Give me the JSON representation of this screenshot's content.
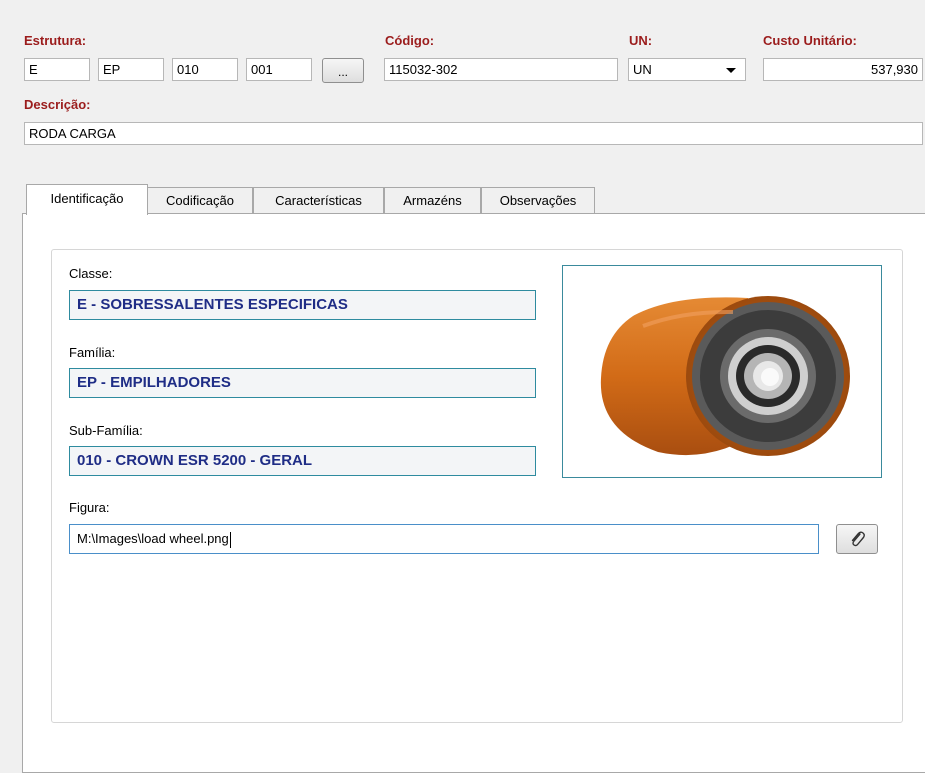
{
  "header": {
    "estrutura_label": "Estrutura:",
    "estrutura_values": [
      "E",
      "EP",
      "010",
      "001"
    ],
    "browse_label": "...",
    "codigo_label": "Código:",
    "codigo_value": "115032-302",
    "un_label": "UN:",
    "un_value": "UN",
    "custo_label": "Custo Unitário:",
    "custo_value": "537,930",
    "descricao_label": "Descrição:",
    "descricao_value": "RODA CARGA"
  },
  "tabs": [
    {
      "label": "Identificação",
      "active": true
    },
    {
      "label": "Codificação",
      "active": false
    },
    {
      "label": "Características",
      "active": false
    },
    {
      "label": "Armazéns",
      "active": false
    },
    {
      "label": "Observações",
      "active": false
    }
  ],
  "identificacao": {
    "classe_label": "Classe:",
    "classe_value": "E - SOBRESSALENTES ESPECIFICAS",
    "familia_label": "Família:",
    "familia_value": "EP - EMPILHADORES",
    "subfamilia_label": "Sub-Família:",
    "subfamilia_value": "010 - CROWN ESR 5200 - GERAL",
    "figura_label": "Figura:",
    "figura_value": "M:\\Images\\load wheel.png",
    "attach_icon": "paperclip-icon"
  },
  "colors": {
    "header_label": "#9b1c1c",
    "readonly_text": "#1f2d86",
    "readonly_border": "#2e8b9f",
    "wheel_tread": "#d9731c"
  }
}
